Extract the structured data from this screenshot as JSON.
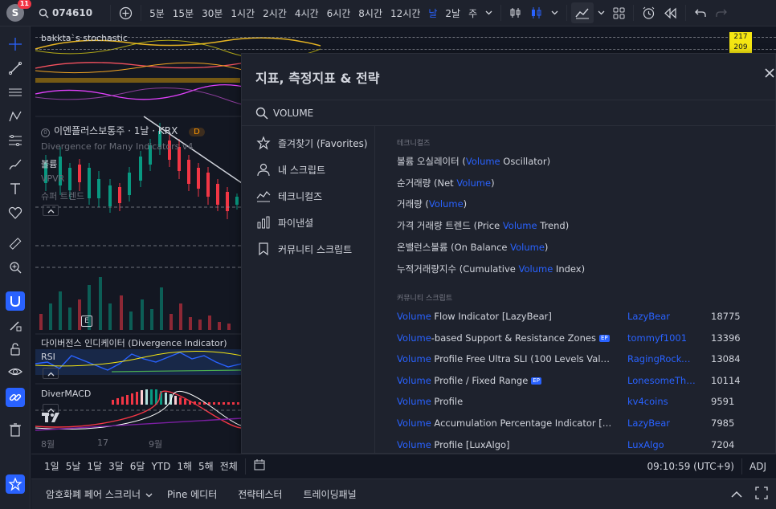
{
  "header": {
    "avatar_letter": "S",
    "notification_count": "11",
    "symbol": "074610",
    "intervals": [
      "5분",
      "15분",
      "30분",
      "1시간",
      "2시간",
      "4시간",
      "6시간",
      "8시간",
      "12시간",
      "날",
      "2날",
      "주"
    ],
    "active_interval": "날"
  },
  "chart": {
    "indicator_name": "bakkta`s stochastic",
    "price_tags": [
      "217",
      "209"
    ],
    "symbol_line": "이엔플러스보통주 · 1날 · KRX",
    "symbol_status": "D",
    "legends": [
      "Divergence for Many Indicators v4",
      "볼륨",
      "VPVR",
      "슈퍼 트렌드"
    ],
    "volume_marker": "E",
    "divergence_label": "다이버전스 인디케이터 (Divergence Indicator)",
    "rsi_label": "RSI",
    "macd_label": "DiverMACD",
    "x_ticks": [
      "8월",
      "17",
      "9월"
    ]
  },
  "dialog": {
    "title": "지표, 측정지표 & 전략",
    "search_value": "VOLUME",
    "categories": [
      {
        "label": "즐겨찾기 (Favorites)",
        "icon": "star-icon"
      },
      {
        "label": "내 스크립트",
        "icon": "user-icon"
      },
      {
        "label": "테크니컬즈",
        "icon": "chart-icon"
      },
      {
        "label": "파이낸셜",
        "icon": "financial-icon"
      },
      {
        "label": "커뮤니티 스크립트",
        "icon": "bookmark-icon"
      }
    ],
    "technicals_heading": "테크니컬즈",
    "technicals": [
      {
        "pre": "볼륨 오실레이터 (",
        "hl": "Volume",
        "post": " Oscillator)"
      },
      {
        "pre": "순거래량 (Net ",
        "hl": "Volume",
        "post": ")"
      },
      {
        "pre": "거래량 (",
        "hl": "Volume",
        "post": ")"
      },
      {
        "pre": "가격 거래량 트렌드 (Price ",
        "hl": "Volume",
        "post": " Trend)"
      },
      {
        "pre": "온밸런스볼륨 (On Balance ",
        "hl": "Volume",
        "post": ")"
      },
      {
        "pre": "누적거래량지수 (Cumulative ",
        "hl": "Volume",
        "post": " Index)"
      }
    ],
    "community_heading": "커뮤니티 스크립트",
    "community": [
      {
        "hl": "Volume",
        "post": " Flow Indicator [LazyBear]",
        "ep": "",
        "author": "LazyBear",
        "likes": "18775"
      },
      {
        "hl": "Volume",
        "post": "-based Support & Resistance Zones",
        "ep": "EP",
        "author": "tommyf1001",
        "likes": "13396"
      },
      {
        "hl": "Volume",
        "post": " Profile Free Ultra SLI (100 Levels Value A…",
        "ep": "",
        "author": "RagingRocket…",
        "likes": "13084"
      },
      {
        "hl": "Volume",
        "post": " Profile / Fixed Range",
        "ep": "EP",
        "author": "LonesomeThe…",
        "likes": "10114"
      },
      {
        "hl": "Volume",
        "post": " Profile",
        "ep": "",
        "author": "kv4coins",
        "likes": "9591"
      },
      {
        "hl": "Volume",
        "post": " Accumulation Percentage Indicator [Lazy…",
        "ep": "",
        "author": "LazyBear",
        "likes": "7985"
      },
      {
        "hl": "Volume",
        "post": " Profile [LuxAlgo]",
        "ep": "",
        "author": "LuxAlgo",
        "likes": "7204"
      }
    ]
  },
  "bottom": {
    "ranges": [
      "1일",
      "5날",
      "1달",
      "3달",
      "6달",
      "YTD",
      "1해",
      "5해",
      "전체"
    ],
    "time": "09:10:59 (UTC+9)",
    "adj": "ADJ"
  },
  "panel": {
    "tabs": [
      "암호화폐 페어 스크리너",
      "Pine 에디터",
      "전략테스터",
      "트레이딩패널"
    ]
  }
}
